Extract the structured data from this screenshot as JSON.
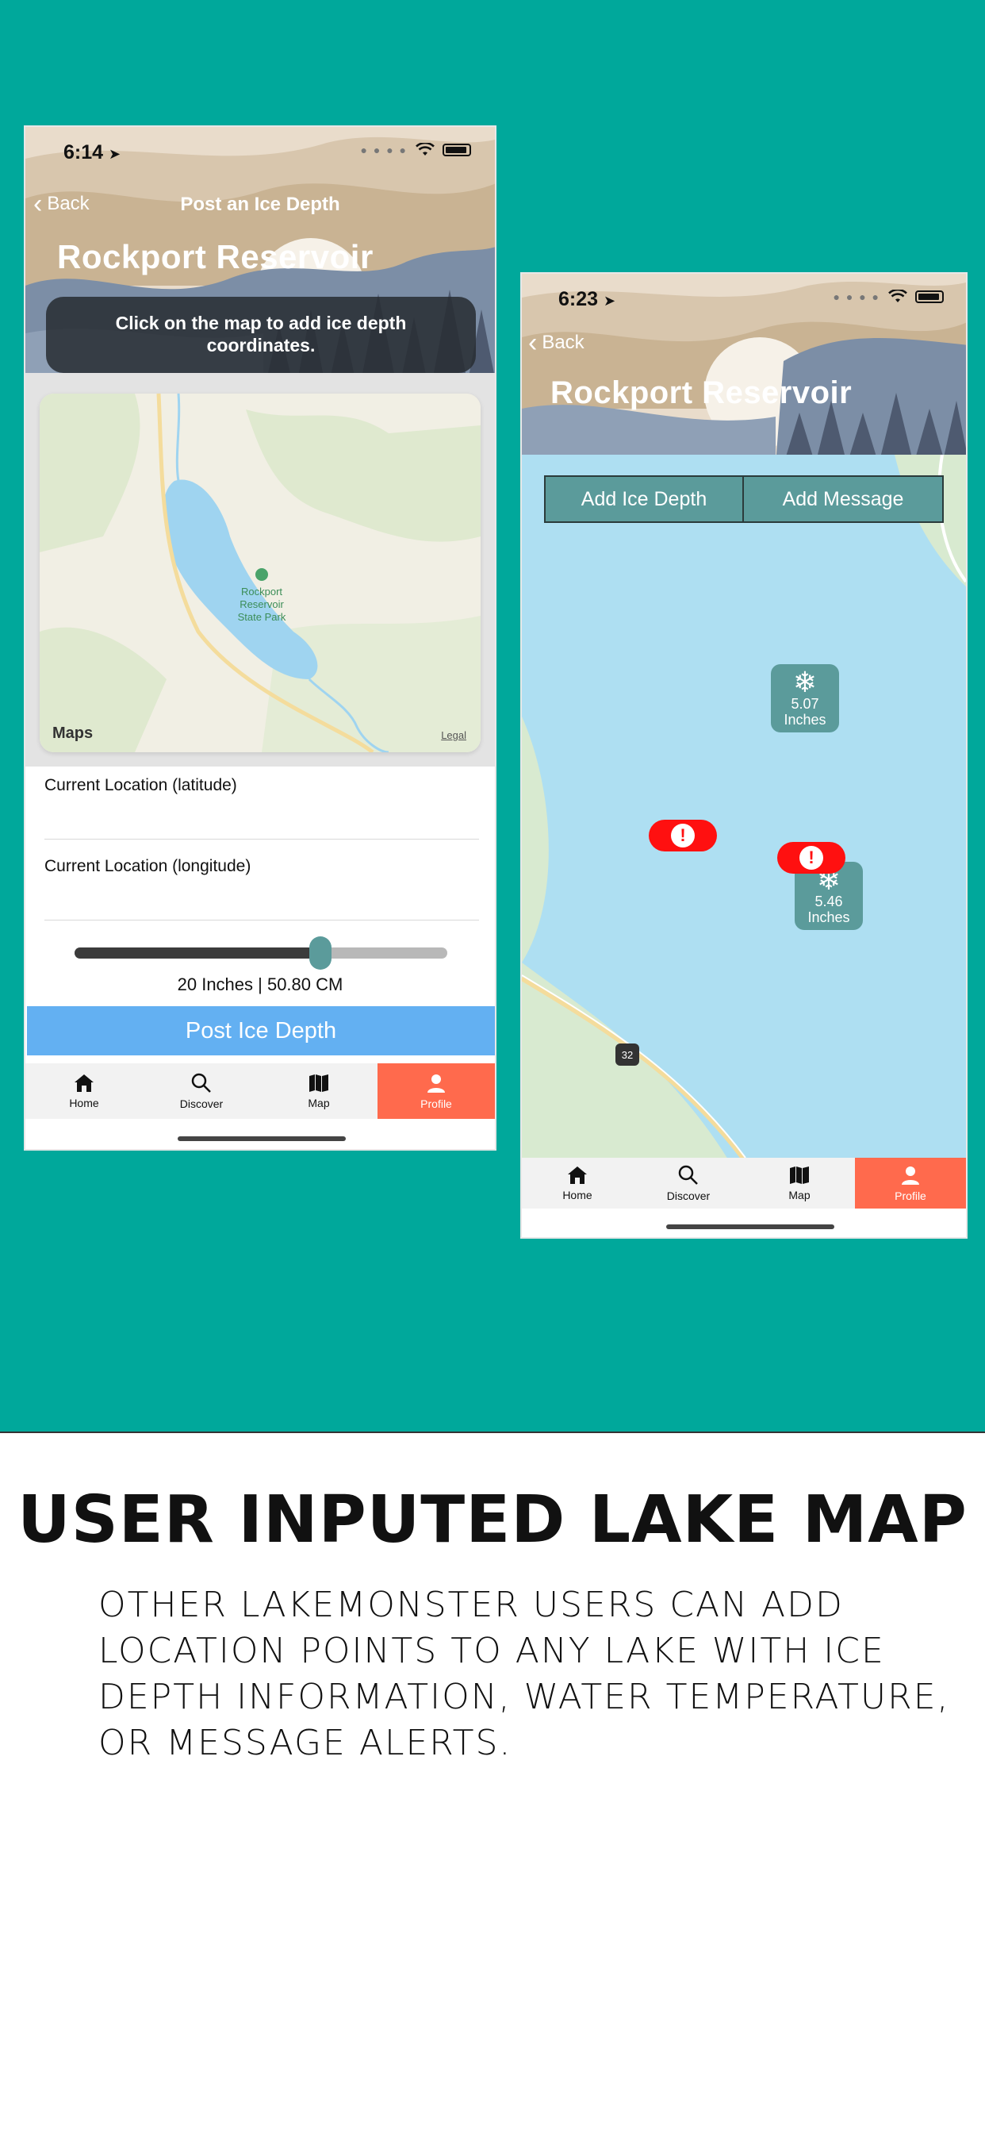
{
  "screen1": {
    "status_time": "6:14",
    "back_label": "Back",
    "nav_title": "Post an Ice Depth",
    "lake_title": "Rockport Reservoir",
    "hint": "Click on the map to add ice depth coordinates.",
    "map_place_label": "Rockport Reservoir State Park",
    "maps_brand": "Maps",
    "legal_link": "Legal",
    "latitude_label": "Current Location (latitude)",
    "longitude_label": "Current Location (longitude)",
    "slider_fraction": 0.66,
    "slider_readout": "20 Inches | 50.80 CM",
    "post_button": "Post Ice Depth",
    "active_tab": "Profile"
  },
  "screen2": {
    "status_time": "6:23",
    "back_label": "Back",
    "lake_title": "Rockport Reservoir",
    "add_ice_depth": "Add Ice Depth",
    "add_message": "Add Message",
    "depth1_value": "5.07",
    "depth1_unit": "Inches",
    "depth2_value": "5.46",
    "depth2_unit": "Inches",
    "route_number": "32",
    "active_tab": "Profile"
  },
  "tabs": [
    {
      "label": "Home",
      "icon": "home-icon"
    },
    {
      "label": "Discover",
      "icon": "search-icon"
    },
    {
      "label": "Map",
      "icon": "map-icon"
    },
    {
      "label": "Profile",
      "icon": "profile-icon"
    }
  ],
  "headline": "USER INPUTED LAKE MAP",
  "description": "OTHER LAKEMONSTER USERS CAN ADD LOCATION POINTS TO ANY LAKE WITH ICE DEPTH INFORMATION, WATER TEMPERATURE, OR MESSAGE ALERTS.",
  "colors": {
    "background": "#00a89b",
    "accent_teal": "#5b9b9b",
    "active_tab": "#ff6a4d",
    "post_button": "#63b0f2",
    "alert": "#ff1010",
    "water": "#aedff2"
  }
}
